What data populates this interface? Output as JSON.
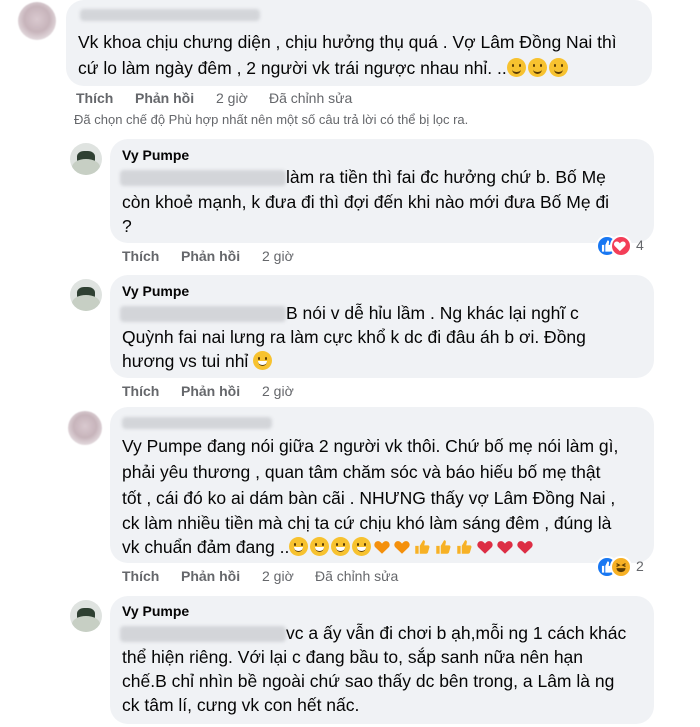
{
  "comments": [
    {
      "author": "",
      "lines": [
        "Vk khoa chịu chưng diện , chịu hưởng thụ quá . Vợ Lâm Đồng Nai thì",
        "cứ lo làm ngày đêm , 2 người vk trái ngược nhau nhỉ. .."
      ],
      "emoji_tail": [
        "slightly-smiling-face",
        "slightly-smiling-face",
        "slightly-smiling-face"
      ],
      "actions": {
        "like": "Thích",
        "reply": "Phản hồi",
        "time": "2 giờ",
        "edited": "Đã chỉnh sửa"
      }
    },
    {
      "author": "Vy Pumpe",
      "lines": [
        "làm ra tiền thì fai đc hưởng chứ b. Bố Mẹ",
        "còn khoẻ mạnh, k đưa đi thì đợi đến khi nào mới đưa Bố Mẹ đi",
        "?"
      ],
      "actions": {
        "like": "Thích",
        "reply": "Phản hồi",
        "time": "2 giờ"
      },
      "reactions": {
        "icons": [
          "like",
          "love"
        ],
        "count": "4"
      }
    },
    {
      "author": "Vy Pumpe",
      "lines": [
        "B nói v dễ hỉu lầm . Ng khác lại nghĩ c",
        "Quỳnh fai nai lưng ra làm cực khổ k dc đi đâu áh b ơi. Đồng",
        "hương vs tui nhỉ"
      ],
      "emoji_tail": [
        "grinning-squinting-face"
      ],
      "actions": {
        "like": "Thích",
        "reply": "Phản hồi",
        "time": "2 giờ"
      }
    },
    {
      "author": "",
      "lines": [
        "Vy Pumpe đang nói giữa 2 người vk thôi. Chứ bố mẹ nói làm gì,",
        "phải yêu thương , quan tâm chăm sóc và báo hiếu bố mẹ thật",
        "tốt , cái đó ko ai dám bàn cãi . NHƯNG thấy vợ Lâm Đồng Nai ,",
        "ck làm nhiều tiền mà chị ta cứ chịu khó làm sáng đêm , đúng là",
        "vk chuẩn đảm đang .."
      ],
      "emoji_tail": [
        "grin",
        "grin",
        "grin",
        "grin",
        "orange-heart",
        "orange-heart",
        "thumbs-up",
        "thumbs-up",
        "thumbs-up",
        "red-heart",
        "red-heart",
        "red-heart"
      ],
      "actions": {
        "like": "Thích",
        "reply": "Phản hồi",
        "time": "2 giờ",
        "edited": "Đã chỉnh sửa"
      },
      "reactions": {
        "icons": [
          "like",
          "haha"
        ],
        "count": "2"
      }
    },
    {
      "author": "Vy Pumpe",
      "lines": [
        "vc a ấy vẫn đi chơi b ạh,mỗi ng 1 cách khác",
        "thể hiện riêng. Với lại c đang bầu to, sắp sanh nữa nên hạn",
        "chế.B chỉ nhìn bề ngoài chứ sao thấy dc bên trong, a Lâm là ng",
        "ck tâm lí, cưng vk con hết nấc."
      ]
    }
  ],
  "filter_note": "Đã chọn chế độ Phù hợp nhất nên một số câu trả lời có thể bị lọc ra.",
  "colors": {
    "bubble": "#f0f2f5",
    "meta": "#65676b",
    "like_blue": "#1877f2",
    "love_red": "#f33e58",
    "haha_yellow": "#f7b125"
  }
}
